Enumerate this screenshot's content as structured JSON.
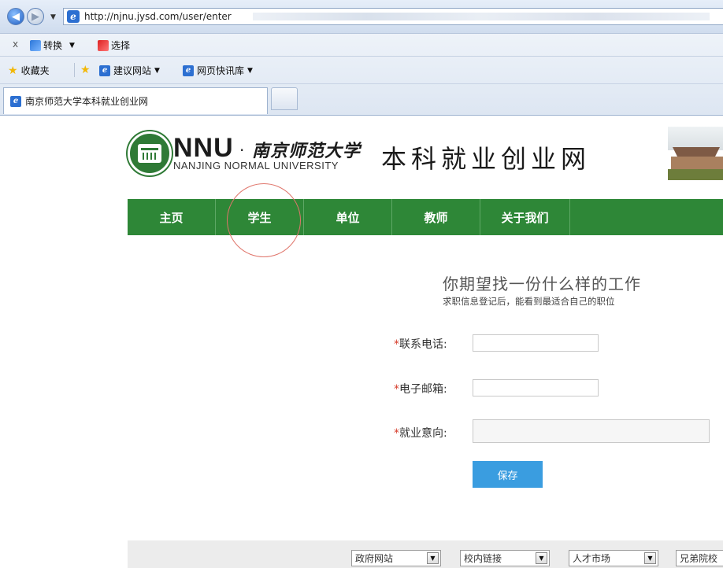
{
  "browser": {
    "url": "http://njnu.jysd.com/user/enter",
    "command_bar": {
      "close": "x",
      "convert": "转换",
      "select": "选择"
    },
    "favorites_bar": {
      "favorites": "收藏夹",
      "suggested_sites": "建议网站",
      "web_slice": "网页快讯库"
    },
    "active_tab": "南京师范大学本科就业创业网"
  },
  "logo": {
    "abbr": "NNU",
    "dot": "·",
    "cn_name": "南京师范大学",
    "en_name": "NANJING NORMAL UNIVERSITY",
    "site_name": "本科就业创业网"
  },
  "nav": {
    "items": [
      "主页",
      "学生",
      "单位",
      "教师",
      "关于我们"
    ]
  },
  "form": {
    "title": "你期望找一份什么样的工作",
    "subtitle": "求职信息登记后，能看到最适合自己的职位",
    "required_mark": "*",
    "phone_label": "联系电话:",
    "email_label": "电子邮箱:",
    "intent_label": "就业意向:",
    "phone_value": "",
    "email_value": "",
    "intent_value": "",
    "save_label": "保存"
  },
  "footer": {
    "selects": [
      "政府网站",
      "校内链接",
      "人才市场",
      "兄弟院校"
    ]
  },
  "colors": {
    "nav_green": "#2e8737",
    "save_blue": "#3a9de0",
    "required_red": "#d63c2a"
  }
}
